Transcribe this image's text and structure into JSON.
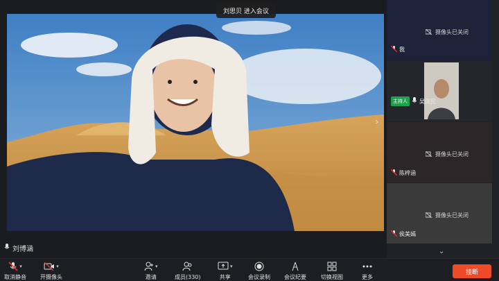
{
  "toast": {
    "text": "刘思贝  进入会议"
  },
  "main_video": {
    "speaker_name": "刘博涵"
  },
  "participants": [
    {
      "name": "我",
      "camera_status": "摄像头已关闭",
      "muted": true,
      "host": false
    },
    {
      "name": "吴保民",
      "camera_status": "",
      "muted": false,
      "host": true,
      "host_label": "主持人"
    },
    {
      "name": "陈梓涵",
      "camera_status": "摄像头已关闭",
      "muted": true,
      "host": false
    },
    {
      "name": "侯美嫣",
      "camera_status": "摄像头已关闭",
      "muted": true,
      "host": false
    }
  ],
  "toolbar": {
    "unmute": "取消静音",
    "camera": "开摄像头",
    "invite": "邀请",
    "members": "成员(330)",
    "share": "共享",
    "record": "会议录制",
    "minutes": "会议纪要",
    "view": "切换视图",
    "more": "更多",
    "leave": "挂断"
  },
  "colors": {
    "leave": "#ef4a28",
    "host_badge": "#1aa34a",
    "mute_red": "#e23b3b"
  }
}
